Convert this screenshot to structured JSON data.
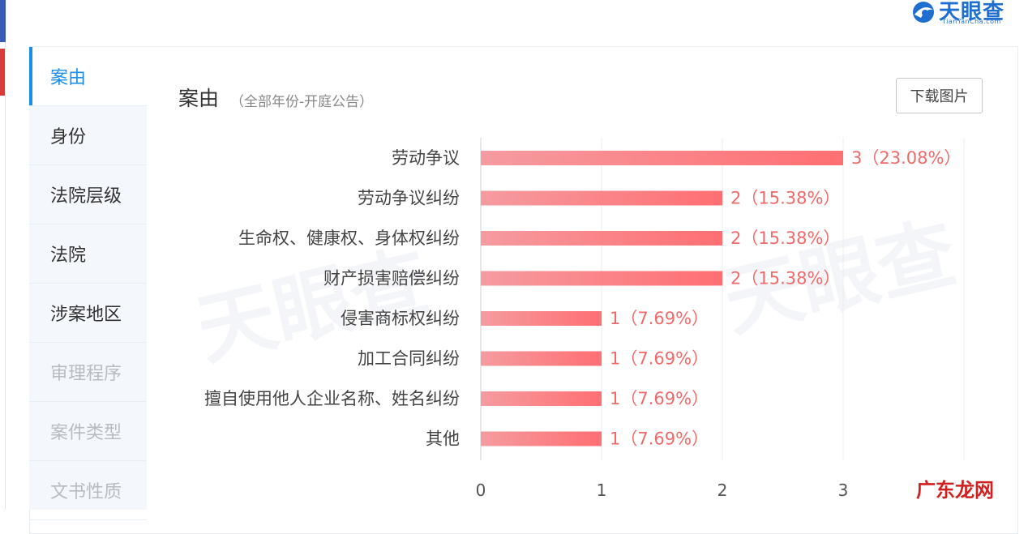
{
  "brand": {
    "name": "天眼查",
    "sub": "TianYanCha.com",
    "corner_text": "广东龙网",
    "colors": {
      "primary": "#1f6fd1",
      "active": "#1d8ee8",
      "bar_start": "#f59ba0",
      "bar_end": "#ff6f72",
      "label": "#f06a6a"
    }
  },
  "sidebar": {
    "items": [
      {
        "label": "案由",
        "state": "active"
      },
      {
        "label": "身份",
        "state": "normal"
      },
      {
        "label": "法院层级",
        "state": "normal"
      },
      {
        "label": "法院",
        "state": "normal"
      },
      {
        "label": "涉案地区",
        "state": "normal"
      },
      {
        "label": "审理程序",
        "state": "disabled"
      },
      {
        "label": "案件类型",
        "state": "disabled"
      },
      {
        "label": "文书性质",
        "state": "disabled"
      }
    ]
  },
  "header": {
    "title": "案由",
    "subtitle": "（全部年份-开庭公告）",
    "download_label": "下载图片"
  },
  "chart_data": {
    "type": "bar",
    "orientation": "horizontal",
    "title": "案由",
    "subtitle": "（全部年份-开庭公告）",
    "categories": [
      "劳动争议",
      "劳动争议纠纷",
      "生命权、健康权、身体权纠纷",
      "财产损害赔偿纠纷",
      "侵害商标权纠纷",
      "加工合同纠纷",
      "擅自使用他人企业名称、姓名纠纷",
      "其他"
    ],
    "values": [
      3,
      2,
      2,
      2,
      1,
      1,
      1,
      1
    ],
    "value_labels": [
      "3（23.08%）",
      "2（15.38%）",
      "2（15.38%）",
      "2（15.38%）",
      "1（7.69%）",
      "1（7.69%）",
      "1（7.69%）",
      "1（7.69%）"
    ],
    "xlim": [
      0,
      4
    ],
    "xticks": [
      0,
      1,
      2,
      3
    ],
    "grid": true,
    "legend": "none"
  }
}
